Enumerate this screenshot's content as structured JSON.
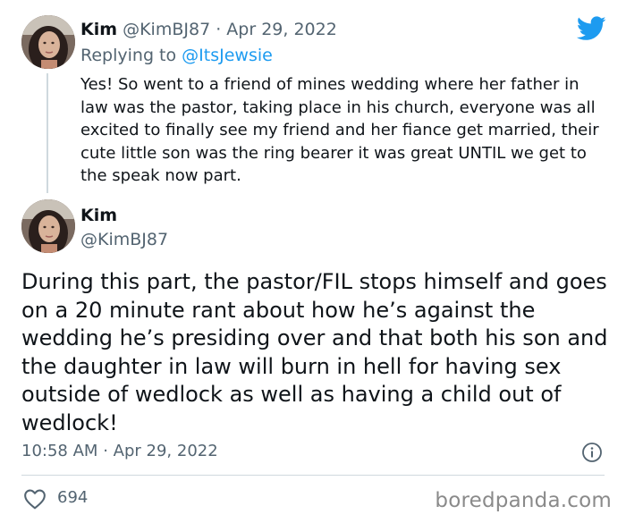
{
  "reply_tweet": {
    "display_name": "Kim",
    "handle": "@KimBJ87",
    "separator": "·",
    "date": "Apr 29, 2022",
    "replying_prefix": "Replying to",
    "replying_to": "@ItsJewsie",
    "text": "Yes! So went to a friend of mines wedding where her father in law was the pastor, taking place in his church, everyone was all excited to finally see my friend and her fiance get married, their cute little son was the ring bearer it was great UNTIL we get to the speak now part."
  },
  "main_tweet": {
    "display_name": "Kim",
    "handle": "@KimBJ87",
    "text": "During this part, the pastor/FIL stops himself and goes on a 20 minute rant about how he’s against the wedding he’s presiding over and that both his son and the daughter in law will burn in hell for having sex outside of wedlock as well as having a child out of wedlock!",
    "time": "10:58 AM",
    "separator": "·",
    "date": "Apr 29, 2022",
    "likes": "694"
  },
  "watermark": "boredpanda.com",
  "icons": {
    "logo": "twitter-bird-icon",
    "info": "info-icon",
    "like": "heart-icon"
  },
  "colors": {
    "twitter_blue": "#1d9bf0",
    "muted_text": "#536471",
    "primary_text": "#0f1419",
    "divider": "#cfd9de"
  }
}
